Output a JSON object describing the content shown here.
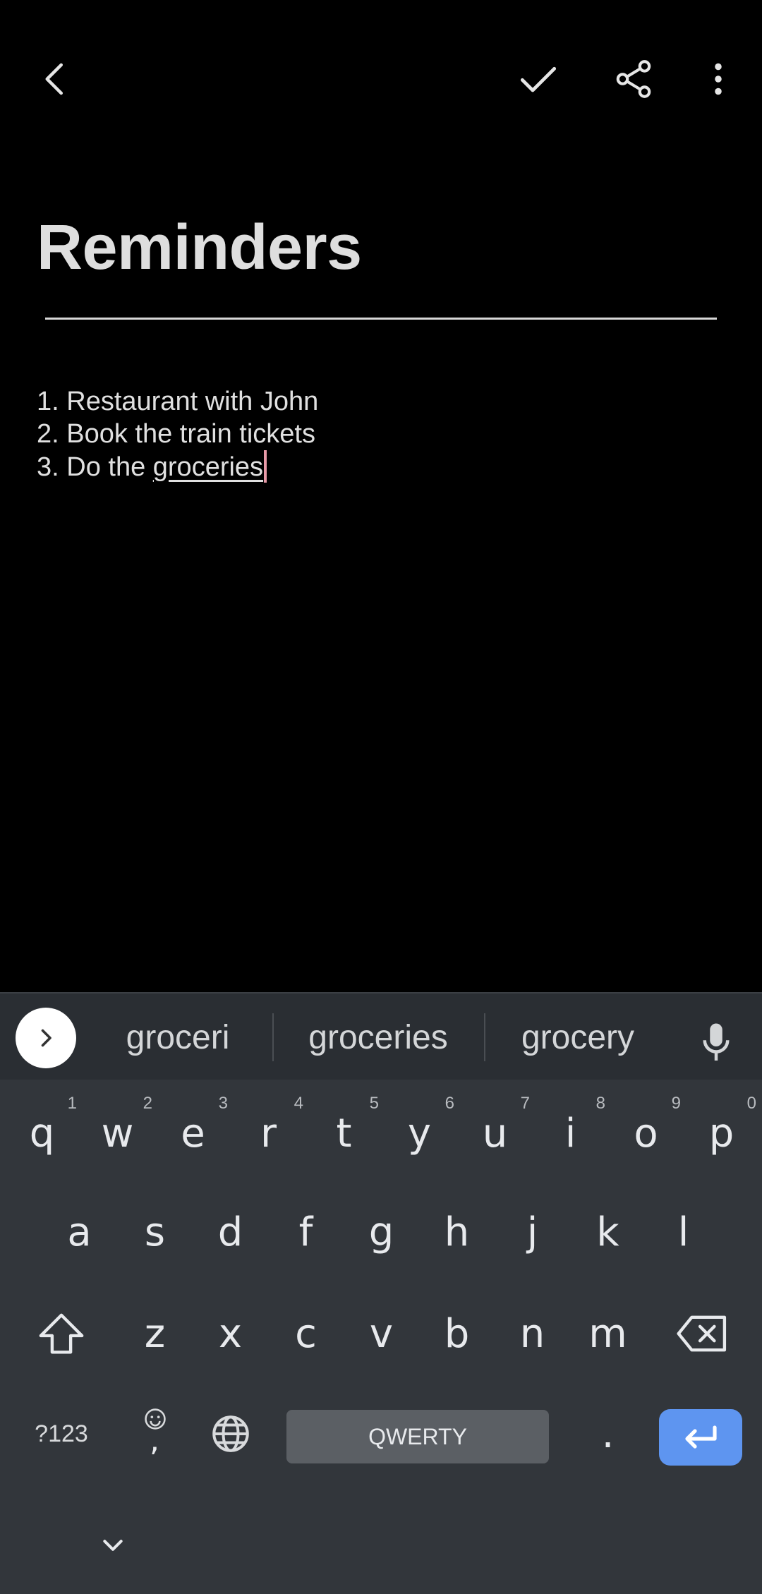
{
  "topbar": {
    "icons": [
      "back-arrow-icon",
      "checkmark-icon",
      "share-icon",
      "more-vert-icon"
    ]
  },
  "note": {
    "title": "Reminders",
    "lines": [
      "1. Restaurant with John",
      "2. Book the train tickets",
      "3. Do the "
    ],
    "current_word": "groceries"
  },
  "keyboard": {
    "suggestions": [
      "groceri",
      "groceries",
      "grocery"
    ],
    "row1": [
      {
        "key": "q",
        "hint": "1"
      },
      {
        "key": "w",
        "hint": "2"
      },
      {
        "key": "e",
        "hint": "3"
      },
      {
        "key": "r",
        "hint": "4"
      },
      {
        "key": "t",
        "hint": "5"
      },
      {
        "key": "y",
        "hint": "6"
      },
      {
        "key": "u",
        "hint": "7"
      },
      {
        "key": "i",
        "hint": "8"
      },
      {
        "key": "o",
        "hint": "9"
      },
      {
        "key": "p",
        "hint": "0"
      }
    ],
    "row2": [
      "a",
      "s",
      "d",
      "f",
      "g",
      "h",
      "j",
      "k",
      "l"
    ],
    "row3": [
      "z",
      "x",
      "c",
      "v",
      "b",
      "n",
      "m"
    ],
    "symbols_label": "?123",
    "comma_label": ",",
    "space_label": "QWERTY",
    "period_label": ".",
    "colors": {
      "background": "#32363b",
      "suggestion_bar": "#2a2e33",
      "enter": "#5e95f0",
      "cursor": "#e79aa7"
    }
  }
}
